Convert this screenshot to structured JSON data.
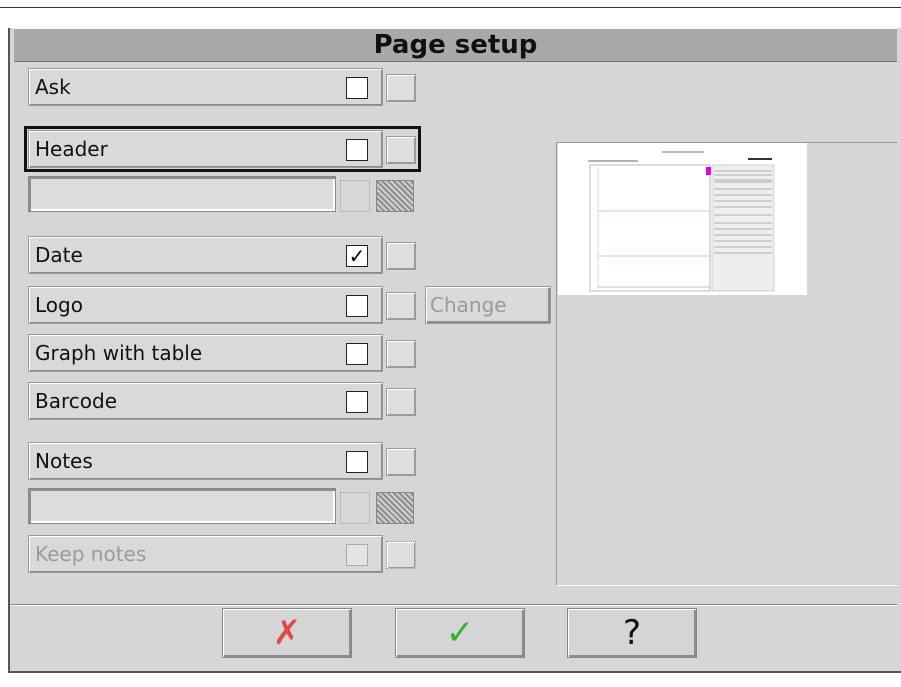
{
  "dialog": {
    "title": "Page setup"
  },
  "options": {
    "ask": {
      "label": "Ask",
      "checked": false
    },
    "header": {
      "label": "Header",
      "checked": false,
      "text": ""
    },
    "date": {
      "label": "Date",
      "checked": true,
      "mark": "✓"
    },
    "logo": {
      "label": "Logo",
      "checked": false,
      "change_label": "Change"
    },
    "graph_with_table": {
      "label": "Graph with table",
      "checked": false
    },
    "barcode": {
      "label": "Barcode",
      "checked": false
    },
    "notes": {
      "label": "Notes",
      "checked": false,
      "text": ""
    },
    "keep_notes": {
      "label": "Keep notes",
      "checked": false,
      "enabled": false
    }
  },
  "buttons": {
    "cancel_glyph": "✗",
    "ok_glyph": "✓",
    "help_glyph": "?"
  },
  "colors": {
    "cancel": "#e04848",
    "ok": "#2fb52f",
    "preview_accent": "#e000e0"
  },
  "icons": {
    "cancel": "x-icon",
    "ok": "check-icon",
    "help": "question-icon"
  }
}
